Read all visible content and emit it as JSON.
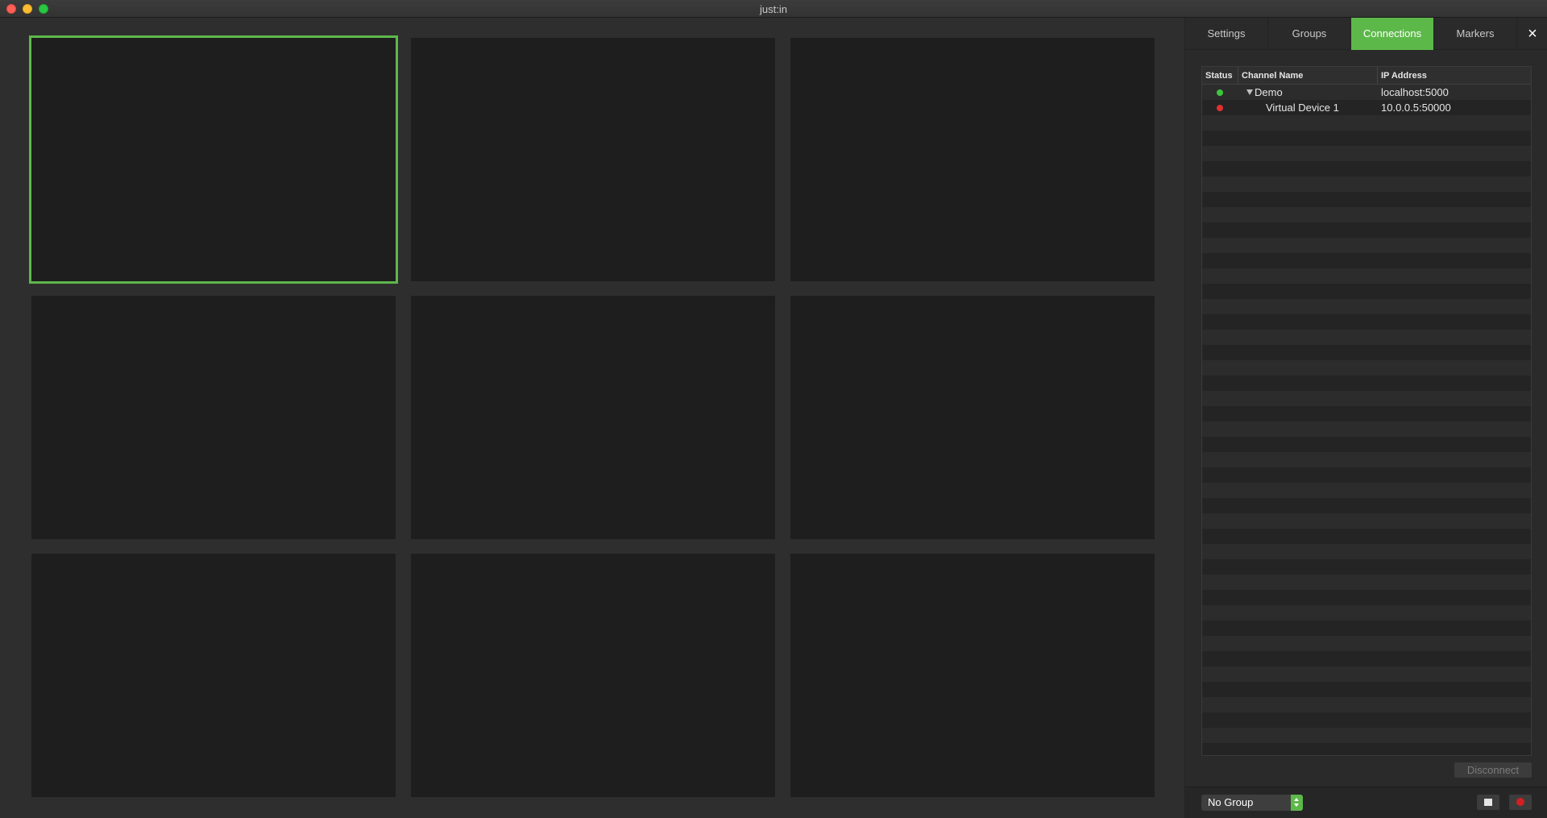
{
  "window": {
    "title": "just:in"
  },
  "tabs": [
    {
      "label": "Settings",
      "active": false
    },
    {
      "label": "Groups",
      "active": false
    },
    {
      "label": "Connections",
      "active": true
    },
    {
      "label": "Markers",
      "active": false
    }
  ],
  "close_icon": "×",
  "table": {
    "headers": {
      "status": "Status",
      "channel": "Channel Name",
      "ip": "IP Address"
    },
    "rows": [
      {
        "status": "connected",
        "channel": "Demo",
        "ip": "localhost:5000",
        "expanded": true
      },
      {
        "status": "disconnected",
        "channel": "Virtual Device 1",
        "ip": "10.0.0.5:50000"
      }
    ]
  },
  "disconnect_label": "Disconnect",
  "group_select": {
    "value": "No Group"
  },
  "colors": {
    "accent": "#5db84a",
    "status_ok": "#3cc63c",
    "status_err": "#e03030"
  },
  "video_grid": {
    "rows": 3,
    "cols": 3,
    "selected_index": 0
  }
}
